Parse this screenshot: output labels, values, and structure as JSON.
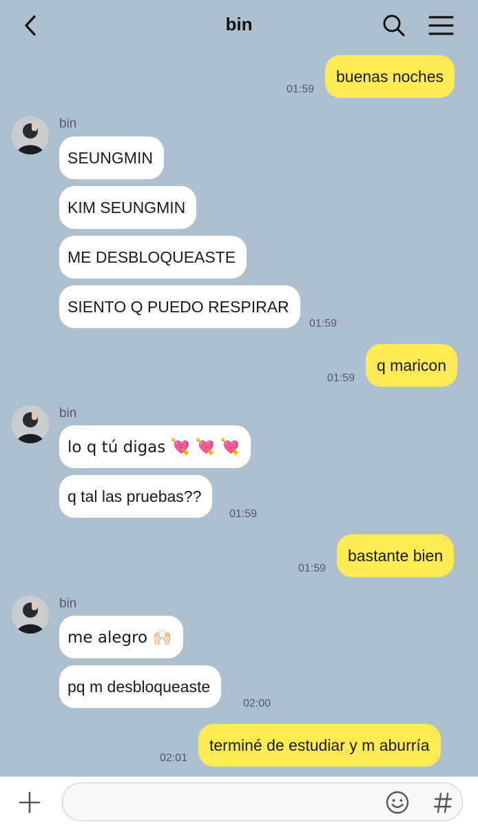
{
  "header": {
    "title": "bin"
  },
  "contact_name": "bin",
  "messages": [
    {
      "dir": "out",
      "text": "buenas noches",
      "time": "01:59"
    },
    {
      "dir": "in",
      "text": "SEUNGMIN"
    },
    {
      "dir": "in",
      "text": "KIM SEUNGMIN"
    },
    {
      "dir": "in",
      "text": "ME DESBLOQUEASTE"
    },
    {
      "dir": "in",
      "text": "SIENTO Q PUEDO RESPIRAR",
      "time": "01:59"
    },
    {
      "dir": "out",
      "text": "q maricon",
      "time": "01:59"
    },
    {
      "dir": "in",
      "text": "lo q tú digas 💘 💘 💘"
    },
    {
      "dir": "in",
      "text": "q tal las pruebas??",
      "time": "01:59"
    },
    {
      "dir": "out",
      "text": "bastante bien",
      "time": "01:59"
    },
    {
      "dir": "in",
      "text": "me alegro 🙌🏻"
    },
    {
      "dir": "in",
      "text": "pq m desbloqueaste",
      "time": "02:00"
    },
    {
      "dir": "out",
      "text": "terminé de estudiar y m aburría",
      "time": "02:01"
    }
  ],
  "composer": {
    "placeholder": ""
  },
  "icons": {
    "back": "chevron-left-icon",
    "search": "search-icon",
    "menu": "hamburger-menu-icon",
    "add": "plus-icon",
    "emoticon": "smiley-icon",
    "hashtag": "hashtag-icon"
  },
  "colors": {
    "background": "#aebfd0",
    "outgoing_bubble": "#fdea55",
    "incoming_bubble": "#ffffff"
  }
}
